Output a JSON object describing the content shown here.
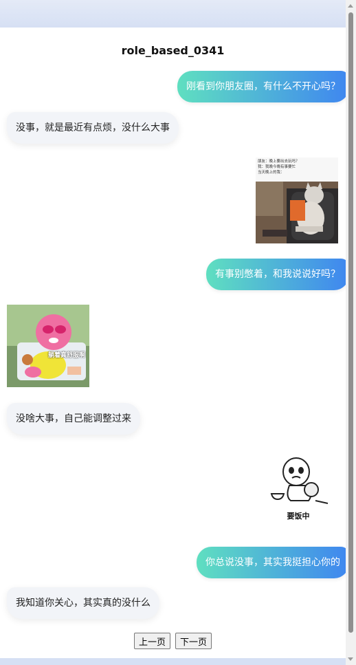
{
  "chat": {
    "title": "role_based_0341",
    "messages": [
      {
        "side": "right",
        "text": "刚看到你朋友圈，有什么不开心吗？"
      },
      {
        "side": "left",
        "text": "没事，就是最近有点烦，没什么大事"
      },
      {
        "side": "right",
        "sticker": "cat-sitting-sticker",
        "caption_lines": [
          "朋友：晚上要出去玩吗？",
          "我：我晚今晚有事要忙",
          "当天晚上的我："
        ]
      },
      {
        "side": "right",
        "text": "有事别憋着，和我说说好吗？"
      },
      {
        "side": "left",
        "sticker": "pink-creature-sticker",
        "caption": "躺着真舒服啊"
      },
      {
        "side": "left",
        "text": "没啥大事，自己能调整过来"
      },
      {
        "side": "right",
        "sticker": "crying-boy-eating-sticker",
        "caption": "要饭中"
      },
      {
        "side": "right",
        "text": "你总说没事，其实我挺担心你的"
      },
      {
        "side": "left",
        "text": "我知道你关心，其实真的没什么"
      }
    ]
  },
  "pager": {
    "prev_label": "上一页",
    "next_label": "下一页"
  },
  "colors": {
    "bubble_gradient_start": "#5fdfc0",
    "bubble_gradient_end": "#3f86f0",
    "left_bubble": "#f2f4f8"
  }
}
